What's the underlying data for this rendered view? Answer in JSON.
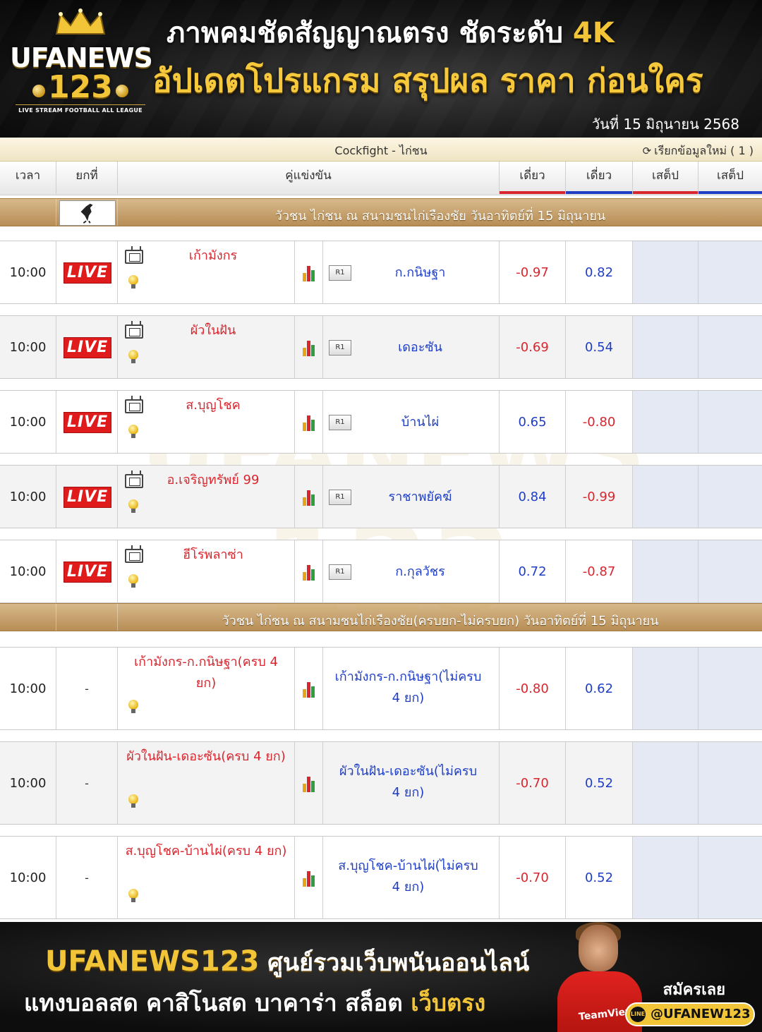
{
  "header": {
    "logo_main": "UFANEWS",
    "logo_number": "123",
    "logo_tagline": "LIVE STREAM FOOTBALL ALL LEAGUE",
    "headline1_main": "ภาพคมชัดสัญญาณตรง ชัดระดับ ",
    "headline1_accent": "4K",
    "headline2": "อัปเดตโปรแกรม สรุปผล ราคา ก่อนใคร",
    "date": "วันที่ 15 มิถุนายน 2568"
  },
  "board": {
    "title": "Cockfight - ไก่ชน",
    "refresh_label": "เรียกข้อมูลใหม่ ( 1 )",
    "watermark_line1": "UFANEWS",
    "watermark_line2": "123",
    "watermark_line3": "LIVE STREAM FOOTBALL ALL LEAGUE",
    "columns": {
      "time": "เวลา",
      "round": "ยกที่",
      "match": "คู่แข่งขัน",
      "single1": "เดี่ยว",
      "single2": "เดี่ยว",
      "parlay1": "เสต็ป",
      "parlay2": "เสต็ป"
    },
    "league1": "วัวชน ไก่ชน ณ สนามชนไก่เรืองชัย วันอาทิตย์ที่ 15 มิถุนายน",
    "league2": "วัวชน ไก่ชน ณ สนามชนไก่เรืองชัย(ครบยก-ไม่ครบยก) วันอาทิตย์ที่ 15 มิถุนายน",
    "live_label": "LIVE",
    "r1_label": "R1",
    "live_matches": [
      {
        "time": "10:00",
        "home": "เก้ามังกร",
        "away": "ก.กนิษฐา",
        "odds1": "-0.97",
        "odds2": "0.82"
      },
      {
        "time": "10:00",
        "home": "ผัวในฝัน",
        "away": "เดอะซัน",
        "odds1": "-0.69",
        "odds2": "0.54"
      },
      {
        "time": "10:00",
        "home": "ส.บุญโชค",
        "away": "บ้านไผ่",
        "odds1": "0.65",
        "odds2": "-0.80"
      },
      {
        "time": "10:00",
        "home": "อ.เจริญทรัพย์ 99",
        "away": "ราชาพยัคฆ์",
        "odds1": "0.84",
        "odds2": "-0.99"
      },
      {
        "time": "10:00",
        "home": "ฮีโร่พลาซ่า",
        "away": "ก.กุลวัชร",
        "odds1": "0.72",
        "odds2": "-0.87"
      }
    ],
    "round_matches": [
      {
        "time": "10:00",
        "round": "-",
        "home": "เก้ามังกร-ก.กนิษฐา(ครบ 4 ยก)",
        "away": "เก้ามังกร-ก.กนิษฐา(ไม่ครบ 4 ยก)",
        "odds1": "-0.80",
        "odds2": "0.62"
      },
      {
        "time": "10:00",
        "round": "-",
        "home": "ผัวในฝัน-เดอะซัน(ครบ 4 ยก)",
        "away": "ผัวในฝัน-เดอะซัน(ไม่ครบ 4 ยก)",
        "odds1": "-0.70",
        "odds2": "0.52"
      },
      {
        "time": "10:00",
        "round": "-",
        "home": "ส.บุญโชค-บ้านไผ่(ครบ 4 ยก)",
        "away": "ส.บุญโชค-บ้านไผ่(ไม่ครบ 4 ยก)",
        "odds1": "-0.70",
        "odds2": "0.52"
      }
    ]
  },
  "footer": {
    "brand": "UFANEWS123",
    "brand_rest": " ศูนย์รวมเว็บพนันออนไลน์",
    "line2_main": "แทงบอลสด คาสิโนสด บาคาร่า สล็อต ",
    "line2_accent": "เว็บตรง",
    "shirt_text": "TeamViewer",
    "signup": "สมัครเลย",
    "line_id": "@UFANEW123",
    "line_badge": "LINE"
  },
  "colors": {
    "gold": "#f2c437",
    "live_red": "#e01b1b",
    "home_red": "#d8262e",
    "away_blue": "#1f3ec4",
    "league_tan": "#c9a46e"
  }
}
